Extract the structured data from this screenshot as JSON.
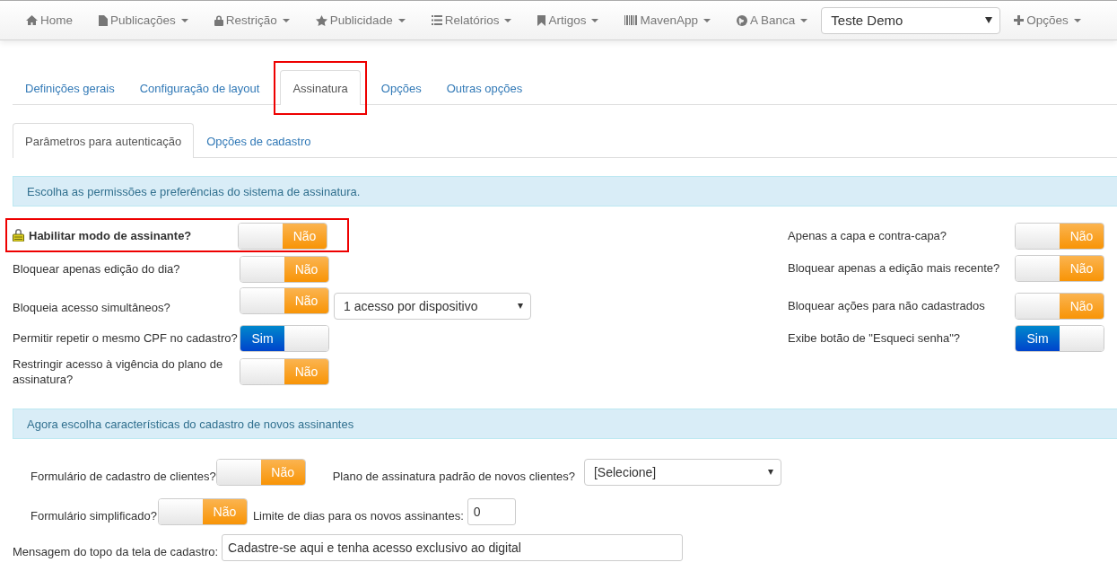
{
  "navbar": {
    "menus": [
      {
        "label": "Home",
        "has_menu": false
      },
      {
        "label": "Publicações",
        "has_menu": true
      },
      {
        "label": "Restrição",
        "has_menu": true
      },
      {
        "label": "Publicidade",
        "has_menu": true
      },
      {
        "label": "Relatórios",
        "has_menu": true
      },
      {
        "label": "Artigos",
        "has_menu": true
      },
      {
        "label": "MavenApp",
        "has_menu": true
      },
      {
        "label": "A Banca",
        "has_menu": true
      }
    ],
    "site_select": {
      "value": "Teste Demo"
    },
    "options_menu": {
      "label": "Opções",
      "has_menu": true
    }
  },
  "tabs": [
    {
      "label": "Definições gerais",
      "selected": false,
      "highlighted": false
    },
    {
      "label": "Configuração de layout",
      "selected": false,
      "highlighted": false
    },
    {
      "label": "Assinatura",
      "selected": true,
      "highlighted": true
    },
    {
      "label": "Opções",
      "selected": false,
      "highlighted": false
    },
    {
      "label": "Outras opções",
      "selected": false,
      "highlighted": false
    }
  ],
  "subtabs": [
    {
      "label": "Parâmetros para autenticação",
      "selected": true
    },
    {
      "label": "Opções de cadastro",
      "selected": false
    }
  ],
  "permissions_notice": "Escolha as permissões e preferências do sistema de assinatura.",
  "left_options": [
    {
      "label": "Habilitar modo de assinante?",
      "locked": true,
      "highlighted": true,
      "toggle": {
        "text": "Não",
        "on": false
      }
    },
    {
      "label": "Bloquear apenas edição do dia?",
      "locked": false,
      "highlighted": false,
      "toggle": {
        "text": "Não",
        "on": false
      }
    },
    {
      "label": "Bloqueia acesso simultâneos?",
      "locked": false,
      "highlighted": false,
      "toggle": {
        "text": "Não",
        "on": false
      },
      "select": {
        "value": "1 acesso por dispositivo"
      }
    },
    {
      "label": "Permitir repetir o mesmo CPF no cadastro?",
      "locked": false,
      "highlighted": false,
      "toggle": {
        "text": "Sim",
        "on": true
      }
    },
    {
      "label": "Restringir acesso à vigência do plano de assinatura?",
      "locked": false,
      "highlighted": false,
      "toggle": {
        "text": "Não",
        "on": false
      }
    }
  ],
  "right_options": [
    {
      "label": "Apenas a capa e contra-capa?",
      "toggle": {
        "text": "Não",
        "on": false
      }
    },
    {
      "label": "Bloquear apenas a edição mais recente?",
      "toggle": {
        "text": "Não",
        "on": false
      }
    },
    {
      "label": "Bloquear ações para não cadastrados",
      "toggle": {
        "text": "Não",
        "on": false
      }
    },
    {
      "label": "Exibe botão de \"Esqueci senha\"?",
      "toggle": {
        "text": "Sim",
        "on": true
      }
    }
  ],
  "registration_notice": "Agora escolha características do cadastro de novos assinantes",
  "registration": {
    "client_form": {
      "label": "Formulário de cadastro de clientes?",
      "toggle": {
        "text": "Não",
        "on": false
      }
    },
    "default_plan": {
      "label": "Plano de assinatura padrão de novos clientes?",
      "value": "[Selecione]"
    },
    "simplified_form": {
      "label": "Formulário simplificado?",
      "toggle": {
        "text": "Não",
        "on": false
      }
    },
    "day_limit": {
      "label": "Limite de dias para os novos assinantes:",
      "value": "0"
    },
    "top_message": {
      "label": "Mensagem do topo da tela de cadastro:",
      "value": "Cadastre-se aqui e tenha acesso exclusivo ao digital"
    }
  }
}
